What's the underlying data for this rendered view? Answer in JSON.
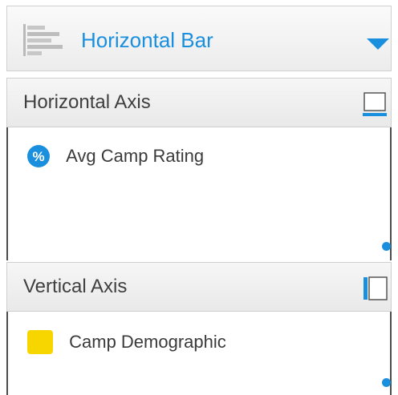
{
  "colors": {
    "accent": "#1a8fdd",
    "percent_badge": "#1a8fdd",
    "dimension_chip": "#f7d600"
  },
  "chart_type": {
    "label": "Horizontal Bar",
    "icon": "horizontal-bar-chart-icon",
    "dropdown_icon": "caret-down-icon"
  },
  "horizontal_axis": {
    "title": "Horizontal Axis",
    "orientation_icon": "horizontal-axis-orientation-icon",
    "field": {
      "label": "Avg Camp Rating",
      "badge": "%",
      "badge_icon": "percent-badge-icon"
    }
  },
  "vertical_axis": {
    "title": "Vertical Axis",
    "orientation_icon": "vertical-axis-orientation-icon",
    "field": {
      "label": "Camp Demographic",
      "chip_icon": "dimension-chip-icon"
    }
  }
}
